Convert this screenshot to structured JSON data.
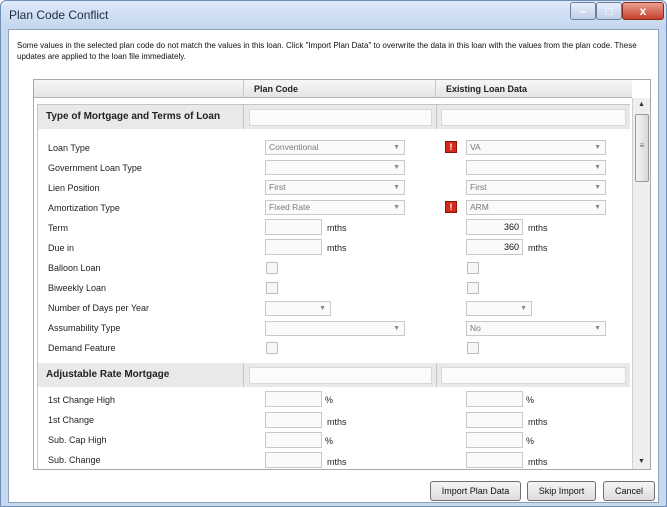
{
  "window": {
    "title": "Plan Code Conflict",
    "minimize": "–",
    "maximize": "□",
    "close": "x"
  },
  "message": "Some values in the selected plan code do not match the values in this loan. Click \"Import Plan Data\" to overwrite the data in this loan with the values from the plan code. These updates are applied to the loan file immediately.",
  "columns": {
    "plan_code": "Plan Code",
    "existing": "Existing Loan Data"
  },
  "sections": [
    {
      "title": "Type of Mortgage and Terms of Loan"
    },
    {
      "title": "Adjustable Rate Mortgage"
    }
  ],
  "rows": {
    "loan_type": {
      "label": "Loan Type",
      "plan": "Conventional",
      "existing": "VA",
      "conflict": true
    },
    "gov_loan_type": {
      "label": "Government Loan Type",
      "plan": "",
      "existing": ""
    },
    "lien_position": {
      "label": "Lien Position",
      "plan": "First",
      "existing": "First"
    },
    "amortization_type": {
      "label": "Amortization Type",
      "plan": "Fixed Rate",
      "existing": "ARM",
      "conflict": true
    },
    "term": {
      "label": "Term",
      "plan": "",
      "existing": "360",
      "unit": "mths"
    },
    "due_in": {
      "label": "Due in",
      "plan": "",
      "existing": "360",
      "unit": "mths"
    },
    "balloon_loan": {
      "label": "Balloon Loan"
    },
    "biweekly_loan": {
      "label": "Biweekly Loan"
    },
    "days_per_year": {
      "label": "Number of Days per Year",
      "plan": "",
      "existing": ""
    },
    "assumability_type": {
      "label": "Assumability Type",
      "plan": "",
      "existing": "No"
    },
    "demand_feature": {
      "label": "Demand Feature"
    },
    "first_change_high": {
      "label": "1st Change High",
      "unit": "%"
    },
    "first_change": {
      "label": "1st Change",
      "unit": "mths"
    },
    "sub_cap_high": {
      "label": "Sub. Cap High",
      "unit": "%"
    },
    "sub_change": {
      "label": "Sub. Change",
      "unit": "mths"
    }
  },
  "icons": {
    "warning": "!",
    "dropdown": "▼",
    "scroll_up": "▲",
    "scroll_down": "▼",
    "grip": "≡"
  },
  "buttons": {
    "import": "Import Plan Data",
    "skip": "Skip Import",
    "cancel": "Cancel"
  }
}
